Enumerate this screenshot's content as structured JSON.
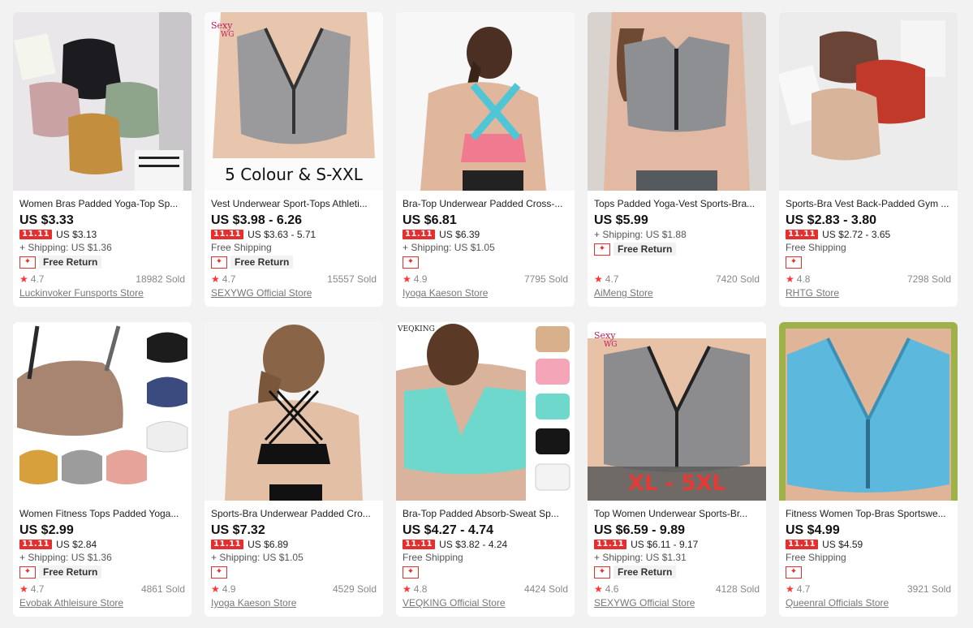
{
  "colors": {
    "accent": "#e62e2e",
    "star": "#ff3333"
  },
  "products": [
    {
      "title": "Women Bras Padded Yoga-Top Sp...",
      "price": "US $3.33",
      "badge": "11.11",
      "promo_price": "US $3.13",
      "shipping": "+ Shipping: US $1.36",
      "free_return": "Free Return",
      "rating": "4.7",
      "sold": "18982 Sold",
      "store": "Luckinvoker Funsports Store",
      "image_overlay": ""
    },
    {
      "title": "Vest Underwear Sport-Tops Athleti...",
      "price": "US $3.98 - 6.26",
      "badge": "11.11",
      "promo_price": "US $3.63 - 5.71",
      "shipping": "Free Shipping",
      "free_return": "Free Return",
      "rating": "4.7",
      "sold": "15557 Sold",
      "store": "SEXYWG Official Store",
      "image_overlay": "5 Colour & S-XXL"
    },
    {
      "title": "Bra-Top Underwear Padded Cross-...",
      "price": "US $6.81",
      "badge": "11.11",
      "promo_price": "US $6.39",
      "shipping": "+ Shipping: US $1.05",
      "free_return": "",
      "rating": "4.9",
      "sold": "7795 Sold",
      "store": "Iyoga Kaeson Store",
      "image_overlay": ""
    },
    {
      "title": "Tops Padded Yoga-Vest Sports-Bra...",
      "price": "US $5.99",
      "badge": "",
      "promo_price": "",
      "shipping": "+ Shipping: US $1.88",
      "free_return": "Free Return",
      "rating": "4.7",
      "sold": "7420 Sold",
      "store": "AiMeng Store",
      "image_overlay": ""
    },
    {
      "title": "Sports-Bra Vest Back-Padded Gym ...",
      "price": "US $2.83 - 3.80",
      "badge": "11.11",
      "promo_price": "US $2.72 - 3.65",
      "shipping": "Free Shipping",
      "free_return": "",
      "rating": "4.8",
      "sold": "7298 Sold",
      "store": "RHTG Store",
      "image_overlay": ""
    },
    {
      "title": "Women Fitness Tops Padded Yoga...",
      "price": "US $2.99",
      "badge": "11.11",
      "promo_price": "US $2.84",
      "shipping": "+ Shipping: US $1.36",
      "free_return": "Free Return",
      "rating": "4.7",
      "sold": "4861 Sold",
      "store": "Evobak Athleisure Store",
      "image_overlay": ""
    },
    {
      "title": "Sports-Bra Underwear Padded Cro...",
      "price": "US $7.32",
      "badge": "11.11",
      "promo_price": "US $6.89",
      "shipping": "+ Shipping: US $1.05",
      "free_return": "",
      "rating": "4.9",
      "sold": "4529 Sold",
      "store": "Iyoga Kaeson Store",
      "image_overlay": ""
    },
    {
      "title": "Bra-Top Padded Absorb-Sweat Sp...",
      "price": "US $4.27 - 4.74",
      "badge": "11.11",
      "promo_price": "US $3.82 - 4.24",
      "shipping": "Free Shipping",
      "free_return": "",
      "rating": "4.8",
      "sold": "4424 Sold",
      "store": "VEQKING Official Store",
      "image_overlay": "VEQKING"
    },
    {
      "title": "Top Women Underwear Sports-Br...",
      "price": "US $6.59 - 9.89",
      "badge": "11.11",
      "promo_price": "US $6.11 - 9.17",
      "shipping": "+ Shipping: US $1.31",
      "free_return": "Free Return",
      "rating": "4.6",
      "sold": "4128 Sold",
      "store": "SEXYWG Official Store",
      "image_overlay": "XL - 5XL"
    },
    {
      "title": "Fitness Women Top-Bras Sportswe...",
      "price": "US $4.99",
      "badge": "11.11",
      "promo_price": "US $4.59",
      "shipping": "Free Shipping",
      "free_return": "",
      "rating": "4.7",
      "sold": "3921 Sold",
      "store": "Queenral Officials Store",
      "image_overlay": ""
    }
  ]
}
